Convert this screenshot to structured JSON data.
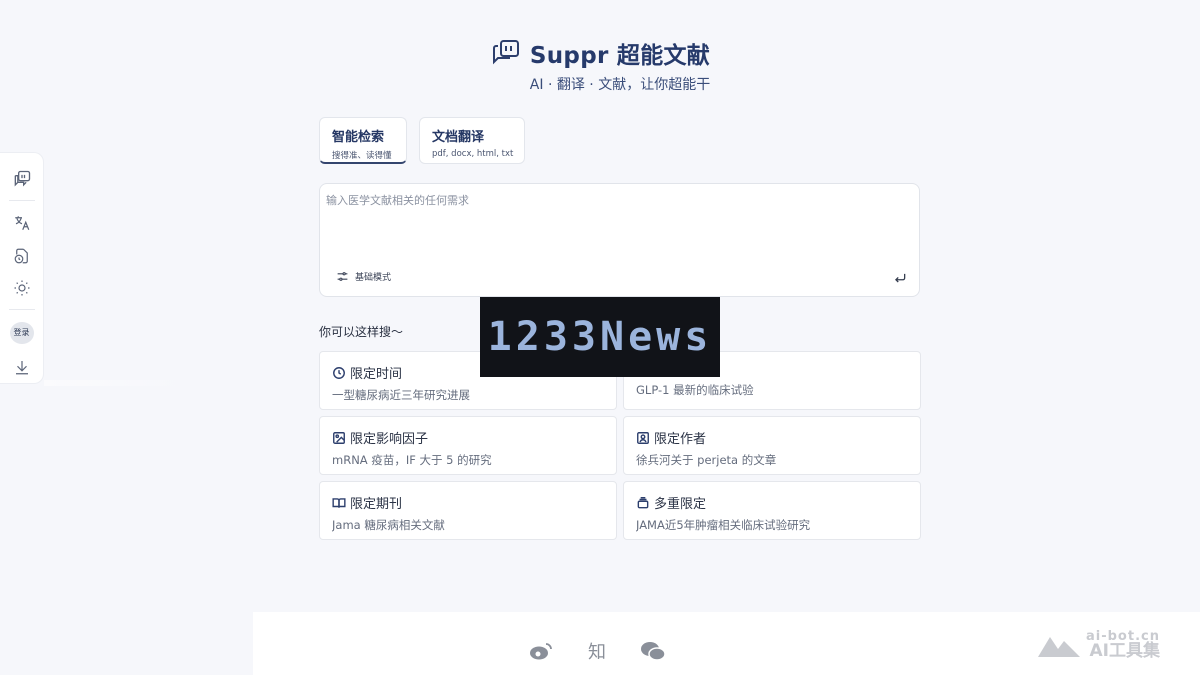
{
  "brand": {
    "title": "Suppr 超能文献",
    "tagline": "AI · 翻译 · 文献，让你超能干"
  },
  "sidebar": {
    "login_label": "登录"
  },
  "tabs": [
    {
      "label": "智能检索",
      "sub": "搜得准、读得懂"
    },
    {
      "label": "文档翻译",
      "sub": "pdf, docx, html, txt"
    }
  ],
  "search": {
    "placeholder": "输入医学文献相关的任何需求",
    "mode_label": "基础模式"
  },
  "banner": {
    "text": "1233News"
  },
  "suggestions": {
    "heading": "你可以这样搜～",
    "items": [
      {
        "title": "限定时间",
        "example": "一型糖尿病近三年研究进展",
        "icon": "clock-icon"
      },
      {
        "title": "",
        "example": "GLP-1 最新的临床试验",
        "icon": "doc-icon"
      },
      {
        "title": "限定影响因子",
        "example": "mRNA 疫苗，IF 大于 5 的研究",
        "icon": "image-icon"
      },
      {
        "title": "限定作者",
        "example": "徐兵河关于 perjeta 的文章",
        "icon": "person-icon"
      },
      {
        "title": "限定期刊",
        "example": "Jama 糖尿病相关文献",
        "icon": "book-icon"
      },
      {
        "title": "多重限定",
        "example": "JAMA近5年肿瘤相关临床试验研究",
        "icon": "layers-icon"
      }
    ]
  },
  "footer": {
    "zhihu_label": "知"
  },
  "watermark": {
    "line1": "ai-bot.cn",
    "line2": "AI工具集"
  }
}
